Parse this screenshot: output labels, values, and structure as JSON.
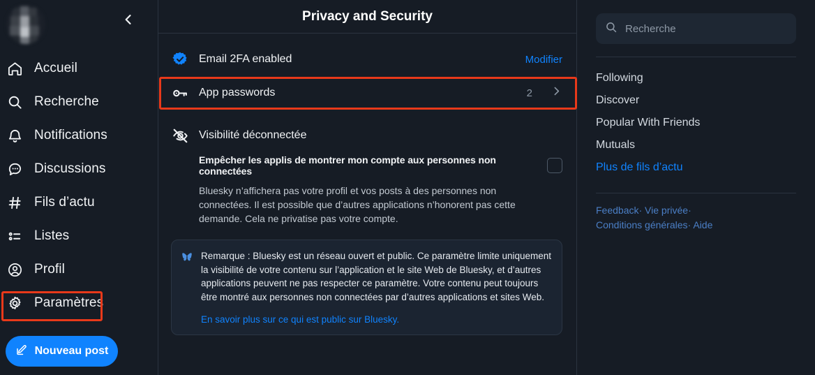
{
  "colors": {
    "background": "#161c25",
    "accent": "#1083fe",
    "highlight": "#e8391a",
    "divider": "#2b3440",
    "muted": "#8d98a5",
    "footer_link": "#4b7fc6"
  },
  "left_sidebar": {
    "collapse_icon": "chevron-left-icon",
    "avatar_alt": "user-avatar",
    "items": [
      {
        "label": "Accueil",
        "icon": "home-icon"
      },
      {
        "label": "Recherche",
        "icon": "search-icon"
      },
      {
        "label": "Notifications",
        "icon": "bell-icon"
      },
      {
        "label": "Discussions",
        "icon": "chat-bubble-icon"
      },
      {
        "label": "Fils d’actu",
        "icon": "hash-icon"
      },
      {
        "label": "Listes",
        "icon": "list-icon"
      },
      {
        "label": "Profil",
        "icon": "person-circle-icon"
      },
      {
        "label": "Paramètres",
        "icon": "gear-icon"
      }
    ],
    "compose": {
      "label": "Nouveau post",
      "icon": "compose-pencil-icon"
    }
  },
  "main": {
    "header": {
      "title": "Privacy and Security"
    },
    "rows": [
      {
        "label": "Email 2FA enabled",
        "icon": "verified-badge-icon",
        "action": "Modifier"
      },
      {
        "label": "App passwords",
        "icon": "key-icon",
        "count": "2",
        "chevron": "chevron-right-icon"
      }
    ],
    "visibility": {
      "icon": "eye-off-icon",
      "title": "Visibilité déconnectée",
      "toggle_label": "Empêcher les applis de montrer mon compte aux personnes non connectées",
      "checkbox_checked": false,
      "description": "Bluesky n’affichera pas votre profil et vos posts à des personnes non connectées. Il est possible que d’autres applications n’honorent pas cette demande. Cela ne privatise pas votre compte."
    },
    "note": {
      "icon": "bluesky-butterfly-icon",
      "text": "Remarque : Bluesky est un réseau ouvert et public. Ce paramètre limite uniquement la visibilité de votre contenu sur l’application et le site Web de Bluesky, et d’autres applications peuvent ne pas respecter ce paramètre. Votre contenu peut toujours être montré aux personnes non connectées par d’autres applications et sites Web.",
      "link": "En savoir plus sur ce qui est public sur Bluesky."
    }
  },
  "right_sidebar": {
    "search": {
      "icon": "search-icon",
      "placeholder": "Recherche",
      "value": ""
    },
    "feeds": [
      {
        "label": "Following",
        "highlighted": false
      },
      {
        "label": "Discover",
        "highlighted": false
      },
      {
        "label": "Popular With Friends",
        "highlighted": false
      },
      {
        "label": "Mutuals",
        "highlighted": false
      },
      {
        "label": "Plus de fils d’actu",
        "highlighted": true
      }
    ],
    "footer": {
      "links": [
        "Feedback",
        "Vie privée",
        "Conditions générales",
        "Aide"
      ],
      "separator": "·"
    }
  },
  "annotations": [
    {
      "name": "settings-highlight",
      "target": "Paramètres"
    },
    {
      "name": "app-passwords-highlight",
      "target": "App passwords"
    }
  ]
}
